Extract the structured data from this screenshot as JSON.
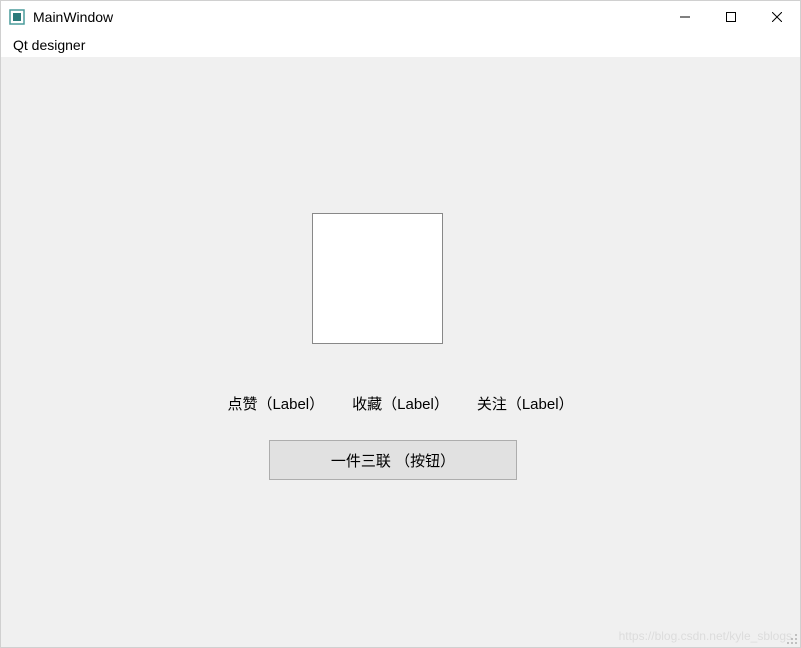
{
  "window": {
    "title": "MainWindow"
  },
  "menu": {
    "qt_designer": "Qt designer"
  },
  "labels": {
    "like": "点赞（Label）",
    "favorite": "收藏（Label）",
    "follow": "关注（Label）"
  },
  "button": {
    "triple": "一件三联 （按钮）"
  },
  "watermark": "https://blog.csdn.net/kyle_sblogs"
}
